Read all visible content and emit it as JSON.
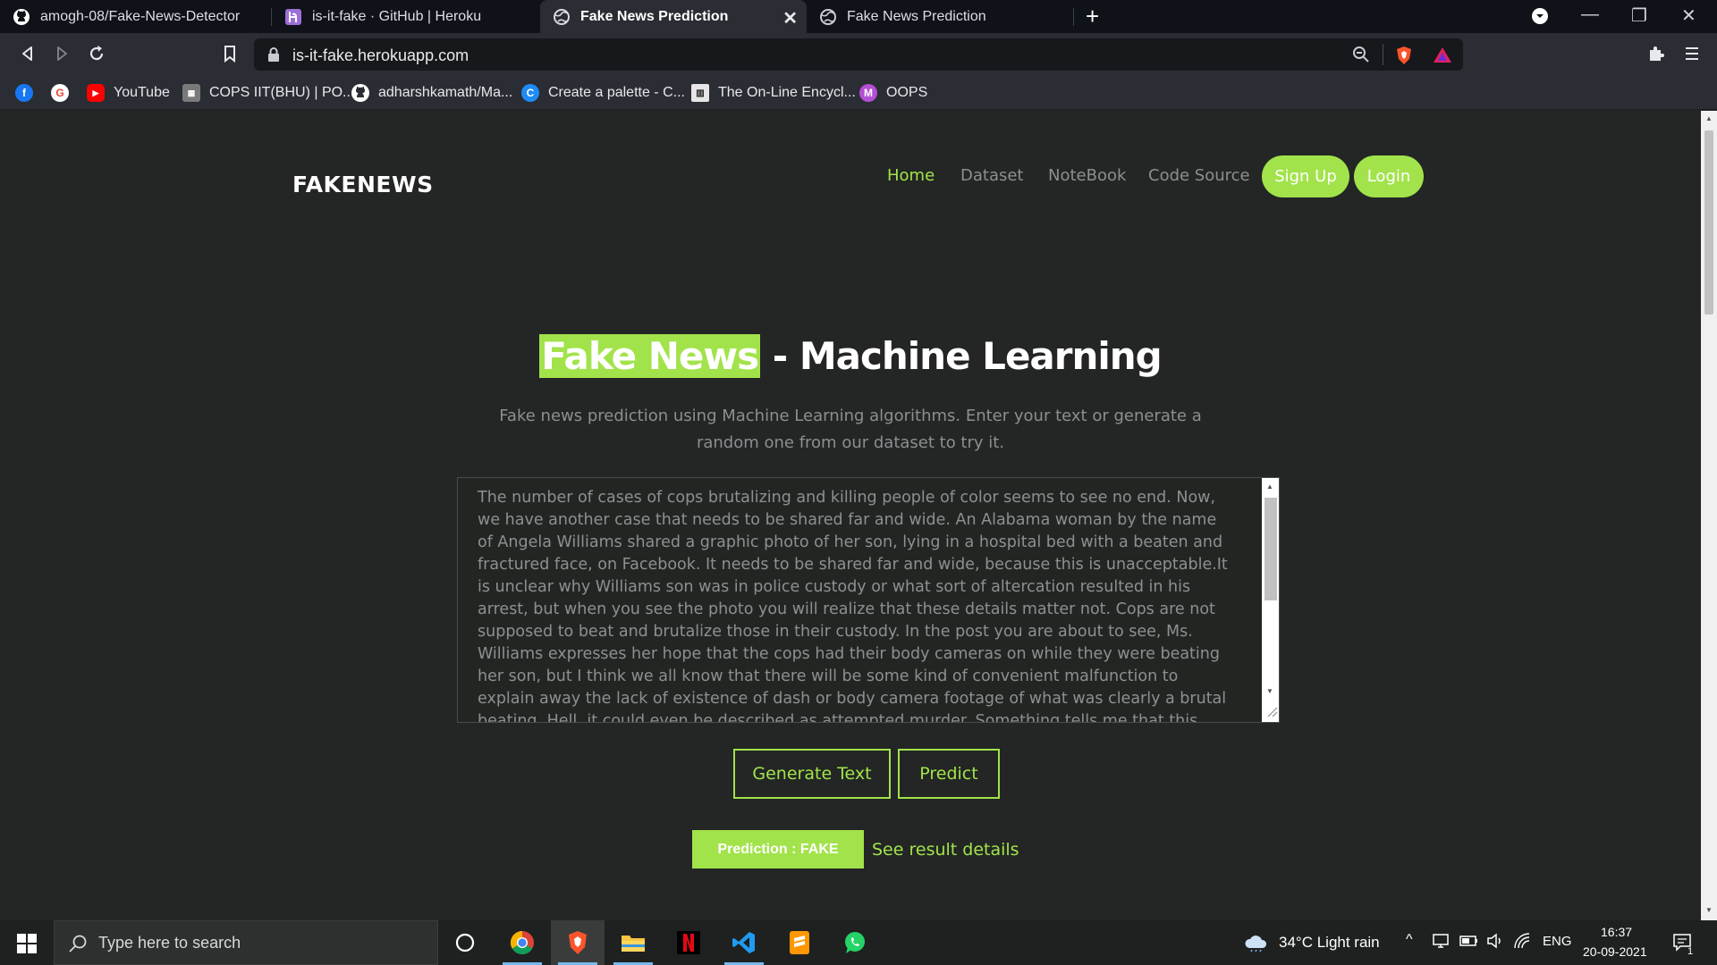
{
  "browser": {
    "tabs": [
      {
        "label": "amogh-08/Fake-News-Detector",
        "icon": "github-icon",
        "active": false
      },
      {
        "label": "is-it-fake · GitHub | Heroku",
        "icon": "heroku-icon",
        "active": false
      },
      {
        "label": "Fake News Prediction",
        "icon": "globe-icon",
        "active": true
      },
      {
        "label": "Fake News Prediction",
        "icon": "globe-icon",
        "active": false
      }
    ],
    "url": "is-it-fake.herokuapp.com",
    "bookmarks": [
      {
        "label": "",
        "icon": "facebook-icon",
        "color": "#1877f2"
      },
      {
        "label": "",
        "icon": "google-icon",
        "color": "#ffffff"
      },
      {
        "label": "YouTube",
        "icon": "youtube-icon",
        "color": "#ff0000"
      },
      {
        "label": "COPS IIT(BHU) | PO...",
        "icon": "cops-icon",
        "color": "#cccccc"
      },
      {
        "label": "adharshkamath/Ma...",
        "icon": "github-icon",
        "color": "#ffffff"
      },
      {
        "label": "Create a palette - C...",
        "icon": "coolors-icon",
        "color": "#1d8cf8"
      },
      {
        "label": "The On-Line Encycl...",
        "icon": "oeis-icon",
        "color": "#ffffff"
      },
      {
        "label": "OOPS",
        "icon": "m-icon",
        "color": "#b44fd6",
        "letter": "M"
      }
    ]
  },
  "page": {
    "brand": "FAKENEWS",
    "nav": [
      "Home",
      "Dataset",
      "NoteBook",
      "Code Source"
    ],
    "signup_label": "Sign Up",
    "login_label": "Login",
    "hero_highlight": "Fake News",
    "hero_rest": " - Machine Learning",
    "subtitle": "Fake news prediction using Machine Learning algorithms. Enter your text or generate a random one from our dataset to try it.",
    "news_text": "The number of cases of cops brutalizing and killing people of color seems to see no end. Now, we have another case that needs to be shared far and wide. An Alabama woman by the name of Angela Williams shared a graphic photo of her son, lying in a hospital bed with a beaten and fractured face, on Facebook. It needs to be shared far and wide, because this is unacceptable.It is unclear why Williams  son was in police custody or what sort of altercation resulted in his arrest, but when you see the photo you will realize that these details matter not. Cops are not supposed to beat and brutalize those in their custody. In the post you are about to see, Ms. Williams expresses her hope that the cops had their body cameras on while they were beating her son, but I think we all know that there will be some kind of convenient  malfunction  to explain away the lack of existence of dash or body camera footage of what was clearly a brutal beating. Hell, it could even be described as attempted murder. Something tells me that this",
    "generate_label": "Generate Text",
    "predict_label": "Predict",
    "prediction_label": "Prediction : FAKE",
    "result_link": "See result details",
    "accent": "#a2e34b"
  },
  "taskbar": {
    "search_placeholder": "Type here to search",
    "apps": [
      "cortana-icon",
      "chrome-icon",
      "brave-icon",
      "file-explorer-icon",
      "netflix-icon",
      "vscode-icon",
      "sublime-icon",
      "whatsapp-icon"
    ],
    "weather": "34°C  Light rain",
    "lang": "ENG",
    "time": "16:37",
    "date": "20-09-2021",
    "notifications": "1"
  }
}
